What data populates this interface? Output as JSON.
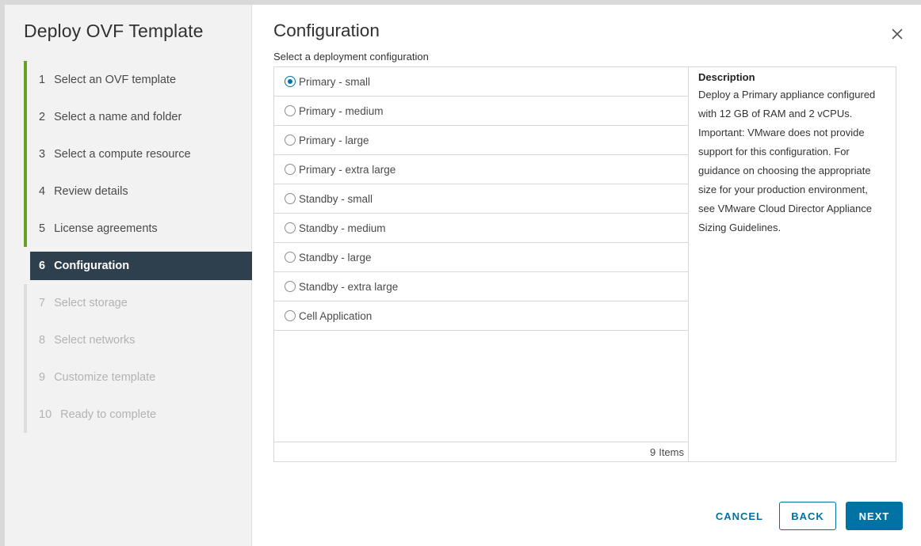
{
  "wizard": {
    "title": "Deploy OVF Template",
    "steps": [
      {
        "num": "1",
        "label": "Select an OVF template"
      },
      {
        "num": "2",
        "label": "Select a name and folder"
      },
      {
        "num": "3",
        "label": "Select a compute resource"
      },
      {
        "num": "4",
        "label": "Review details"
      },
      {
        "num": "5",
        "label": "License agreements"
      },
      {
        "num": "6",
        "label": "Configuration"
      },
      {
        "num": "7",
        "label": "Select storage"
      },
      {
        "num": "8",
        "label": "Select networks"
      },
      {
        "num": "9",
        "label": "Customize template"
      },
      {
        "num": "10",
        "label": "Ready to complete"
      }
    ]
  },
  "main": {
    "title": "Configuration",
    "subtitle": "Select a deployment configuration",
    "options": [
      {
        "label": "Primary - small",
        "selected": true
      },
      {
        "label": "Primary - medium",
        "selected": false
      },
      {
        "label": "Primary - large",
        "selected": false
      },
      {
        "label": "Primary - extra large",
        "selected": false
      },
      {
        "label": "Standby - small",
        "selected": false
      },
      {
        "label": "Standby - medium",
        "selected": false
      },
      {
        "label": "Standby - large",
        "selected": false
      },
      {
        "label": "Standby - extra large",
        "selected": false
      },
      {
        "label": "Cell Application",
        "selected": false
      }
    ],
    "item_count": "9",
    "item_count_unit": "Items",
    "description_label": "Description",
    "description_text": "Deploy a Primary appliance configured with 12 GB of RAM and 2 vCPUs. Important: VMware does not provide support for this configuration. For guidance on choosing the appropriate size for your production environment, see VMware Cloud Director Appliance Sizing Guidelines."
  },
  "actions": {
    "cancel": "CANCEL",
    "back": "BACK",
    "next": "NEXT"
  },
  "colors": {
    "accent": "#0072a3",
    "completed_step": "#62a420",
    "active_step_bg": "#2e3f4d"
  },
  "icons": {
    "close": "close-icon"
  }
}
